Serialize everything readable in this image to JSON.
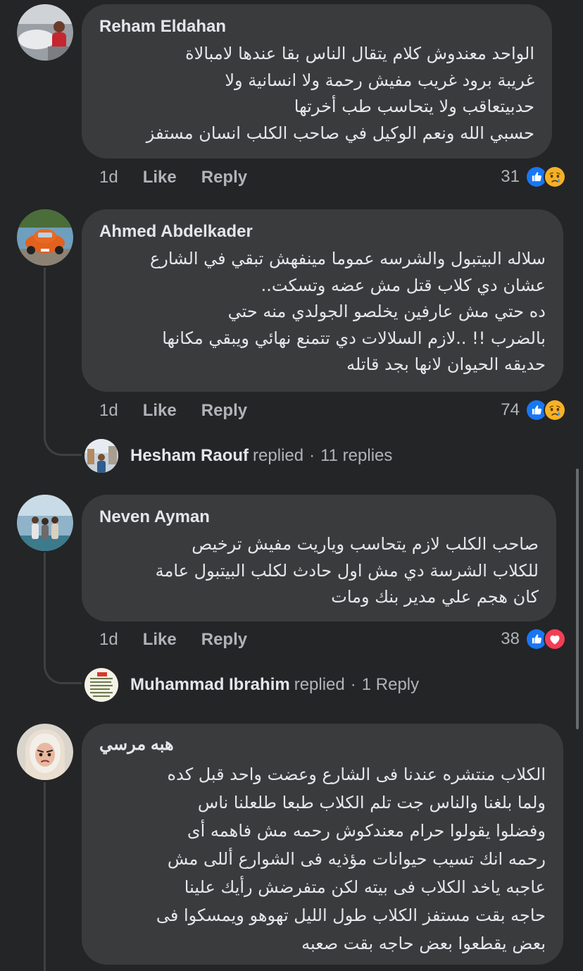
{
  "colors": {
    "background": "#242526",
    "bubble": "#3a3b3c",
    "primary_text": "#e4e6eb",
    "secondary_text": "#b0b3b8",
    "like_blue": "#1877f2",
    "love_red": "#f33e58",
    "sad_yellow": "#f7b125"
  },
  "comments": [
    {
      "author": "Reham Eldahan",
      "lines": [
        "الواحد معندوش كلام يتقال الناس بقا عندها لامبالاة",
        "غريبة برود غريب مفيش رحمة ولا انسانية ولا",
        "حدبيتعاقب ولا يتحاسب طب أخرتها",
        "حسبي الله ونعم الوكيل في صاحب الكلب انسان مستفز"
      ],
      "time": "1d",
      "like_label": "Like",
      "reply_label": "Reply",
      "reaction_count": "31",
      "reaction_icons": [
        "like-icon",
        "sad-icon"
      ]
    },
    {
      "author": "Ahmed Abdelkader",
      "lines": [
        "سلاله البيتبول والشرسه عموما مينفهش تبقي في الشارع",
        "عشان دي كلاب قتل مش عضه وتسكت..",
        "ده حتي مش عارفين يخلصو الجولدي منه حتي",
        "بالضرب !! ..لازم السلالات دي تتمنع نهائي ويبقي مكانها",
        "حديقه الحيوان لانها بجد قاتله"
      ],
      "time": "1d",
      "like_label": "Like",
      "reply_label": "Reply",
      "reaction_count": "74",
      "reaction_icons": [
        "like-icon",
        "sad-icon"
      ],
      "replies": {
        "name": "Hesham Raouf",
        "verb": "replied",
        "sep": "·",
        "count": "11 replies"
      }
    },
    {
      "author": "Neven Ayman",
      "lines": [
        "صاحب الكلب لازم يتحاسب وياريت مفيش ترخيص",
        "للكلاب الشرسة دي مش اول حادث لكلب البيتبول عامة",
        "كان هجم علي مدير بنك ومات"
      ],
      "time": "1d",
      "like_label": "Like",
      "reply_label": "Reply",
      "reaction_count": "38",
      "reaction_icons": [
        "like-icon",
        "love-icon"
      ],
      "replies": {
        "name": "Muhammad Ibrahim",
        "verb": "replied",
        "sep": "·",
        "count": "1 Reply"
      }
    },
    {
      "author": "هبه مرسي",
      "lines": [
        "الكلاب منتشره عندنا فى الشارع وعضت واحد قبل كده",
        "ولما بلغنا والناس جت تلم الكلاب طبعا طلعلنا ناس",
        "وفضلوا يقولوا حرام معندكوش رحمه مش فاهمه أى",
        "رحمه انك تسيب حيوانات مؤذيه فى الشوارع ألل‍ى مش",
        "عاجبه ياخد الكلاب فى بيته لكن متفرضش رأيك علينا",
        "حاجه بقت مستفز الكلاب طول الليل تهوهو ويمسكوا فى",
        "بعض يقطعوا بعض حاجه بقت صعبه"
      ]
    }
  ]
}
